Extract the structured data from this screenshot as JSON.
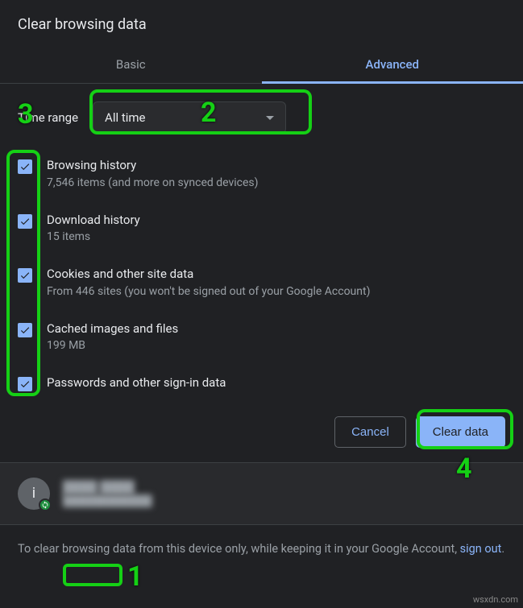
{
  "title": "Clear browsing data",
  "tabs": {
    "basic": "Basic",
    "advanced": "Advanced"
  },
  "range": {
    "label": "Time range",
    "value": "All time"
  },
  "items": [
    {
      "title": "Browsing history",
      "sub": "7,546 items (and more on synced devices)"
    },
    {
      "title": "Download history",
      "sub": "15 items"
    },
    {
      "title": "Cookies and other site data",
      "sub": "From 446 sites (you won't be signed out of your Google Account)"
    },
    {
      "title": "Cached images and files",
      "sub": "199 MB"
    },
    {
      "title": "Passwords and other sign-in data",
      "sub": ""
    }
  ],
  "buttons": {
    "cancel": "Cancel",
    "clear": "Clear data"
  },
  "profile": {
    "initial": "i",
    "name": "████ ████",
    "email": "████████████"
  },
  "footer": {
    "pre": "To clear browsing data from this device only, while keeping it in your Google Account, ",
    "link": "sign out",
    "post": "."
  },
  "annotations": {
    "n1": "1",
    "n2": "2",
    "n3": "3",
    "n4": "4"
  },
  "watermark": "wsxdn.com"
}
